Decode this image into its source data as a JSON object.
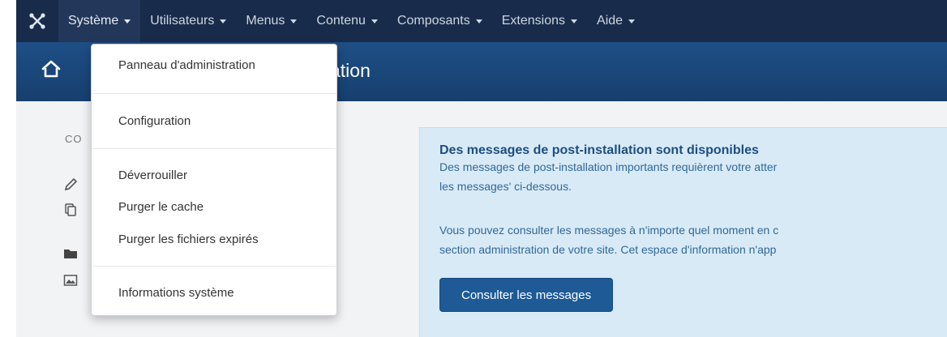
{
  "nav": {
    "items": [
      {
        "label": "Système",
        "active": true
      },
      {
        "label": "Utilisateurs"
      },
      {
        "label": "Menus"
      },
      {
        "label": "Contenu"
      },
      {
        "label": "Composants"
      },
      {
        "label": "Extensions"
      },
      {
        "label": "Aide"
      }
    ]
  },
  "title_bar": {
    "title_fragment": "ation"
  },
  "sidebar": {
    "heading_fragment": "CO"
  },
  "dropdown": {
    "items": [
      "Panneau d'administration",
      "Configuration",
      "Déverrouiller",
      "Purger le cache",
      "Purger les fichiers expirés",
      "Informations système"
    ]
  },
  "info": {
    "title": "Des messages de post-installation sont disponibles",
    "line1": "Des messages de post-installation importants requièrent votre atter",
    "line2": "les messages' ci-dessous.",
    "line3": "Vous pouvez consulter les messages à n'importe quel moment en c",
    "line4": "section administration de votre site. Cet espace d'information n'app",
    "button": "Consulter les messages"
  },
  "colors": {
    "nav_bg": "#182b4a",
    "title_bar": "#1e4f86",
    "info_bg": "#d9eaf7",
    "button": "#1d5a96"
  }
}
